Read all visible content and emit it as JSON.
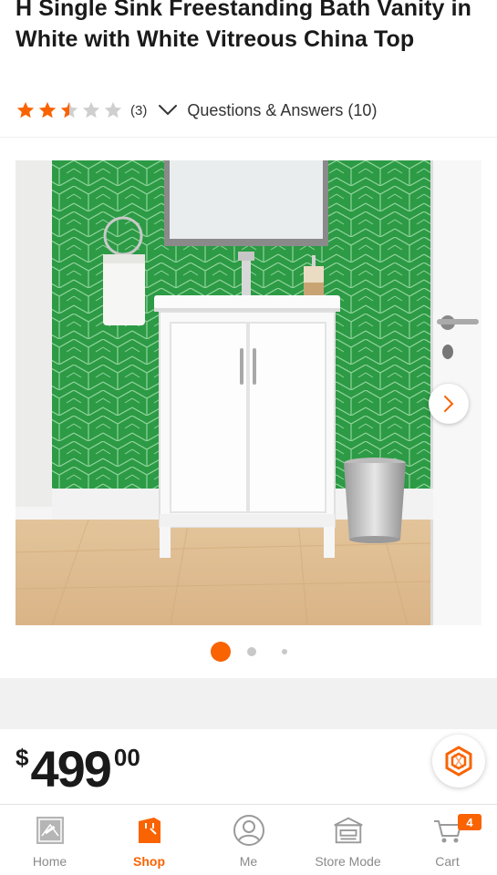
{
  "product": {
    "title": "H Single Sink Freestanding Bath Vanity in White with White Vitreous China Top",
    "rating": 2.5,
    "rating_max": 5,
    "review_count": "(3)",
    "qa_label": "Questions & Answers (10)"
  },
  "gallery": {
    "current_index": 1,
    "image_icon": "bath-vanity-photo",
    "next_icon": "chevron-right-icon"
  },
  "price": {
    "currency": "$",
    "dollars": "499",
    "cents": "00"
  },
  "nav": {
    "items": [
      {
        "label": "Home",
        "icon": "home-depot-logo-icon"
      },
      {
        "label": "Shop",
        "icon": "shop-bag-icon"
      },
      {
        "label": "Me",
        "icon": "user-icon"
      },
      {
        "label": "Store Mode",
        "icon": "store-icon"
      },
      {
        "label": "Cart",
        "icon": "cart-icon",
        "badge": "4"
      }
    ],
    "active": "Shop"
  },
  "colors": {
    "accent": "#f96302",
    "star": "#f96302",
    "star_empty": "#cfcfcf",
    "tile": "#2f9e4a"
  }
}
